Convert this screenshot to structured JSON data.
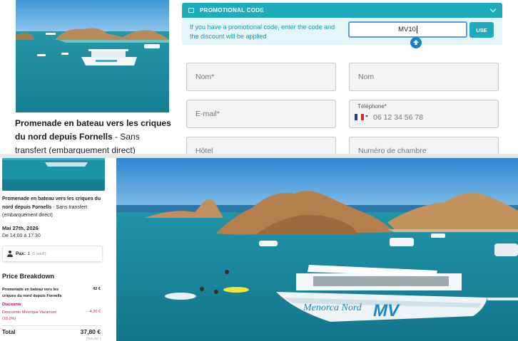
{
  "tour": {
    "title_bold": "Promenade en bateau vers les criques du nord depuis Fornells",
    "title_rest": " - Sans transfert (embarquement direct)"
  },
  "promo": {
    "header": "PROMOTIONAL CODE",
    "help_text": "If you have a promotional code, enter the code and the discount will be applied",
    "code_value": "MV10",
    "use_label": "USE"
  },
  "form": {
    "name_placeholder": "Nom*",
    "surname_placeholder": "Nom",
    "email_placeholder": "E-mail*",
    "phone_label": "Téléphone*",
    "phone_placeholder": "06 12 34 56 78",
    "hotel_placeholder": "Hôtel",
    "room_placeholder": "Numéro de chambre"
  },
  "summary": {
    "date": "Mai 27th, 2026",
    "time": "De 14:00 à 17:30",
    "pax_label": "Pax:",
    "pax_value": "1",
    "pax_detail": "(1 adult)"
  },
  "price_breakdown": {
    "title": "Price Breakdown",
    "item_label": "Promenade en bateau vers les criques du nord depuis Fornells",
    "item_price": "42 €",
    "discounts_label": "Discounts",
    "discount_text": "Descuento Minorque Vacances (10.0%)",
    "discount_value": "-4,20 €",
    "total_label": "Total",
    "total_value": "37,80 €",
    "tax_note": "(TVA incl.)"
  },
  "photo": {
    "boat_name": "Menorca Nord",
    "boat_logo": "MV"
  },
  "colors": {
    "accent": "#1eabbc",
    "promo_bg": "#e4f6f7",
    "discount": "#c2185b",
    "sea": "#1f8fa8",
    "sky": "#4a9ed8"
  }
}
